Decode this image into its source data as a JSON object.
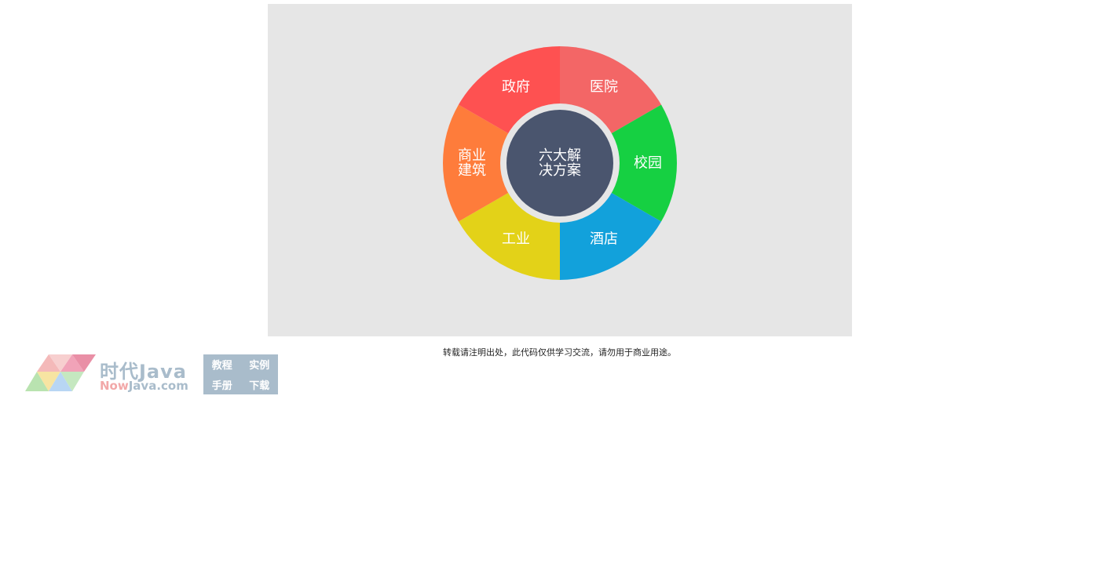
{
  "solutions": {
    "center": "六大解\n决方案",
    "center_color": "#4a556e",
    "ring_color": "#e6e6e6",
    "segments": [
      {
        "label": "医院",
        "color": "#f36666"
      },
      {
        "label": "校园",
        "color": "#16d042"
      },
      {
        "label": "酒店",
        "color": "#12a1db"
      },
      {
        "label": "工业",
        "color": "#e3d218"
      },
      {
        "label": "商业\n建筑",
        "color": "#fe7c3b"
      },
      {
        "label": "政府",
        "color": "#fe5151"
      }
    ]
  },
  "notice": "转载请注明出处，此代码仅供学习交流，请勿用于商业用途。",
  "logo": {
    "title": "时代Java",
    "subtitle_now": "Now",
    "subtitle_rest": "Java.com",
    "nav": [
      "教程",
      "实例",
      "手册",
      "下载"
    ]
  }
}
